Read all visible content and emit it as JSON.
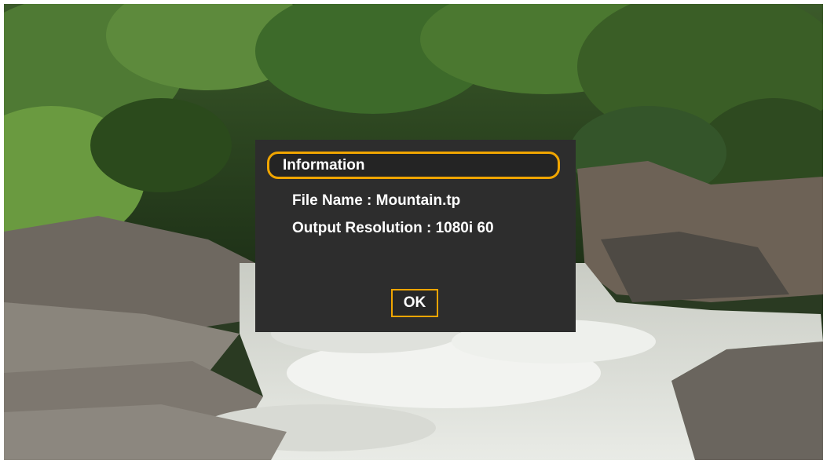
{
  "dialog": {
    "title": "Information",
    "file_name_line": "File Name : Mountain.tp",
    "resolution_line": "Output Resolution : 1080i 60",
    "ok_label": "OK"
  },
  "colors": {
    "dialog_background": "#2d2d2d",
    "accent": "#f0a500",
    "text": "#ffffff"
  }
}
